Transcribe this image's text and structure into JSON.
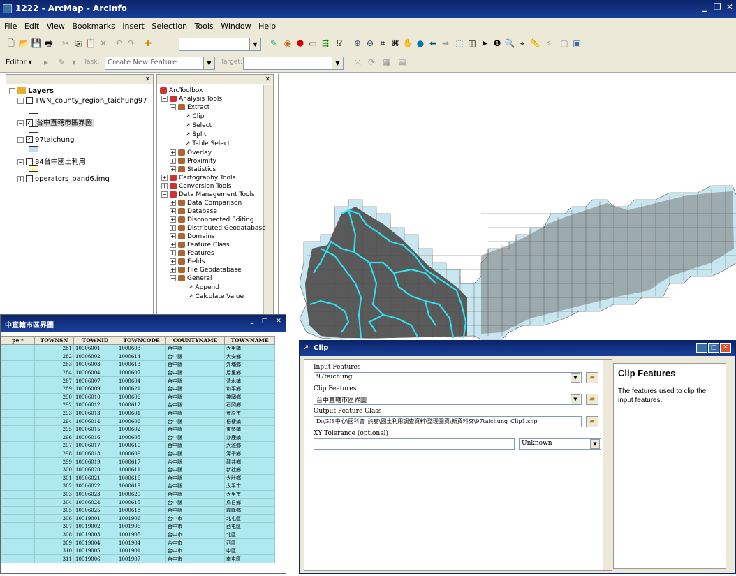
{
  "window": {
    "title": "1222 - ArcMap - ArcInfo",
    "controls": [
      "_",
      "❐",
      "✕"
    ]
  },
  "menu": [
    "File",
    "Edit",
    "View",
    "Bookmarks",
    "Insert",
    "Selection",
    "Tools",
    "Window",
    "Help"
  ],
  "editor_toolbar": {
    "editor_label": "Editor ▾",
    "task_label": "Task:",
    "task_value": "Create New Feature",
    "target_label": "Target:"
  },
  "toc": {
    "root": "Layers",
    "layers": [
      {
        "name": "TWN_county_region_taichung97",
        "checked": false,
        "color": "#ffffff"
      },
      {
        "name": "台中直轄市區界圖",
        "checked": true,
        "color": "#ffffff"
      },
      {
        "name": "97taichung",
        "checked": true,
        "color": "#bfdfef"
      },
      {
        "name": "84台中國土利用",
        "checked": false,
        "color": "#ffffc0"
      },
      {
        "name": "operators_band6.img",
        "checked": false,
        "color": ""
      }
    ]
  },
  "toolbox": {
    "items": [
      "ArcToolbox",
      "Analysis Tools",
      "Extract",
      "Clip",
      "Select",
      "Split",
      "Table Select",
      "Overlay",
      "Proximity",
      "Statistics",
      "Cartography Tools",
      "Conversion Tools",
      "Data Management Tools",
      "Data Comparison",
      "Database",
      "Disconnected Editing",
      "Distributed Geodatabase",
      "Domains",
      "Feature Class",
      "Features",
      "Fields",
      "File Geodatabase",
      "General",
      "Append",
      "Calculate Value"
    ]
  },
  "attr": {
    "title": "中直轄市區界圖",
    "columns": [
      "pe *",
      "TOWNSN",
      "TOWNID",
      "TOWNCODE",
      "COUNTYNAME",
      "TOWNNAME"
    ],
    "rows": [
      [
        "",
        "281",
        "10006001",
        "1000603",
        "台中縣",
        "大甲鎮"
      ],
      [
        "",
        "282",
        "10006002",
        "1000614",
        "台中縣",
        "大安鄉"
      ],
      [
        "",
        "283",
        "10006003",
        "1000613",
        "台中縣",
        "外埔鄉"
      ],
      [
        "",
        "284",
        "10006004",
        "1000607",
        "台中縣",
        "后里鄉"
      ],
      [
        "",
        "287",
        "10006007",
        "1000604",
        "台中縣",
        "清水鎮"
      ],
      [
        "",
        "289",
        "10006009",
        "1000621",
        "台中縣",
        "和平鄉"
      ],
      [
        "",
        "290",
        "10006010",
        "1000606",
        "台中縣",
        "神岡鄉"
      ],
      [
        "",
        "292",
        "10006012",
        "1000612",
        "台中縣",
        "石岡鄉"
      ],
      [
        "",
        "293",
        "10006013",
        "1000601",
        "台中縣",
        "豐原市"
      ],
      [
        "",
        "294",
        "10006014",
        "1000606",
        "台中縣",
        "梧棲鎮"
      ],
      [
        "",
        "295",
        "10006015",
        "1000602",
        "台中縣",
        "東勢鎮"
      ],
      [
        "",
        "296",
        "10006016",
        "1000605",
        "台中縣",
        "沙鹿鎮"
      ],
      [
        "",
        "297",
        "10006017",
        "1000610",
        "台中縣",
        "大雅鄉"
      ],
      [
        "",
        "298",
        "10006018",
        "1000609",
        "台中縣",
        "潭子鄉"
      ],
      [
        "",
        "299",
        "10006019",
        "1000617",
        "台中縣",
        "龍井鄉"
      ],
      [
        "",
        "300",
        "10006020",
        "1000611",
        "台中縣",
        "新社鄉"
      ],
      [
        "",
        "301",
        "10006021",
        "1000616",
        "台中縣",
        "大肚鄉"
      ],
      [
        "",
        "302",
        "10006022",
        "1000619",
        "台中縣",
        "太平市"
      ],
      [
        "",
        "303",
        "10006023",
        "1000620",
        "台中縣",
        "大里市"
      ],
      [
        "",
        "304",
        "10006024",
        "1000615",
        "台中縣",
        "烏日鄉"
      ],
      [
        "",
        "305",
        "10006025",
        "1000618",
        "台中縣",
        "霧峰鄉"
      ],
      [
        "",
        "306",
        "10019001",
        "1001906",
        "台中市",
        "北屯區"
      ],
      [
        "",
        "307",
        "10019002",
        "1001906",
        "台中市",
        "西屯區"
      ],
      [
        "",
        "308",
        "10019003",
        "1001905",
        "台中市",
        "北區"
      ],
      [
        "",
        "309",
        "10019004",
        "1001904",
        "台中市",
        "西區"
      ],
      [
        "",
        "310",
        "10019005",
        "1001901",
        "台中市",
        "中區"
      ],
      [
        "",
        "311",
        "10019006",
        "1001907",
        "台中市",
        "南屯區"
      ]
    ]
  },
  "clip": {
    "title": "Clip",
    "input_label": "Input Features",
    "input_value": "97taichung",
    "clip_label": "Clip Features",
    "clip_value": "台中直轄市區界圖",
    "output_label": "Output Feature Class",
    "output_value": "D:\\GIS中心\\國科會_熱島\\國土利用調查資料\\整理圖資\\新資料夾\\97taichung_Clip1.shp",
    "xy_label": "XY Tolerance (optional)",
    "xy_value": "",
    "unit_value": "Unknown",
    "help_title": "Clip Features",
    "help_text": "The features used to clip the input features."
  },
  "colors": {
    "titlebar": "#0a246a",
    "row_highlight": "#aee9ef",
    "map_fill": "#5a5a5a",
    "map_tiles": "#c8e6f0",
    "boundary": "#2ee0f0"
  }
}
